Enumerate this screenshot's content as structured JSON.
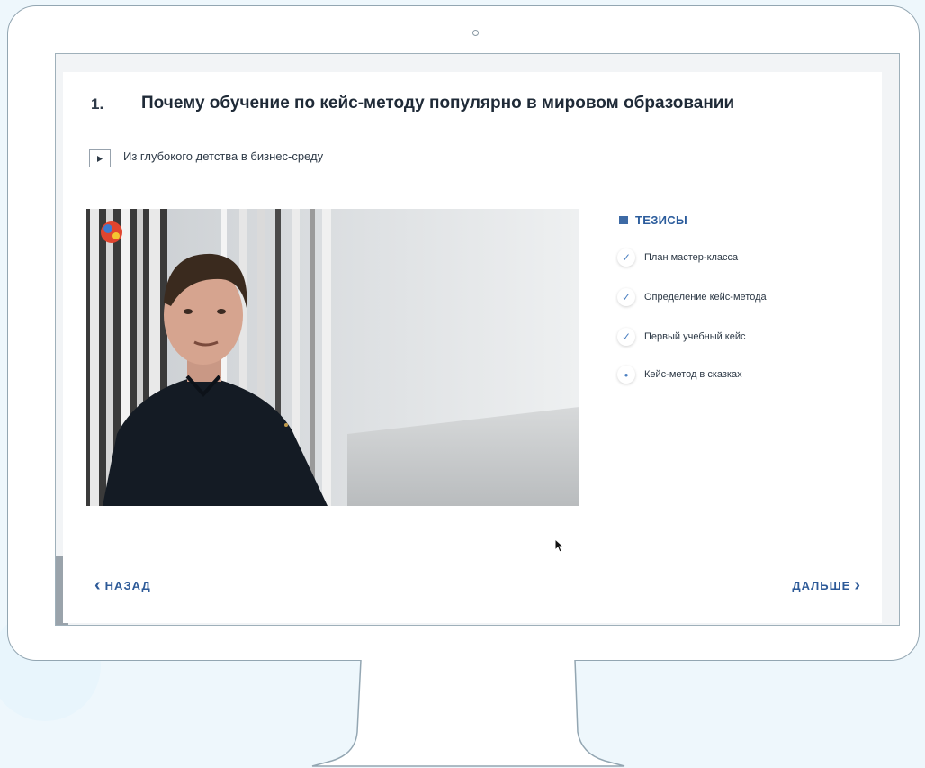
{
  "lesson": {
    "number": "1.",
    "title": "Почему обучение по кейс-методу популярно в мировом образовании",
    "section": "Из глубокого детства в бизнес-среду"
  },
  "video": {
    "content": "presenter-in-hallway"
  },
  "theses": {
    "heading": "ТЕЗИСЫ",
    "items": [
      {
        "label": "План мастер-класса",
        "state": "done"
      },
      {
        "label": "Определение кейс-метода",
        "state": "done"
      },
      {
        "label": "Первый учебный кейс",
        "state": "done"
      },
      {
        "label": "Кейс-метод в сказках",
        "state": "current"
      }
    ]
  },
  "nav": {
    "back": "НАЗАД",
    "next": "ДАЛЬШЕ"
  },
  "icons": {
    "play": "play-icon",
    "thesis": "list-icon",
    "check": "check-icon",
    "cursor": "mouse-pointer-icon"
  },
  "colors": {
    "accent": "#2d5a98",
    "check": "#4a7fc1",
    "background": "#eef7fc"
  }
}
